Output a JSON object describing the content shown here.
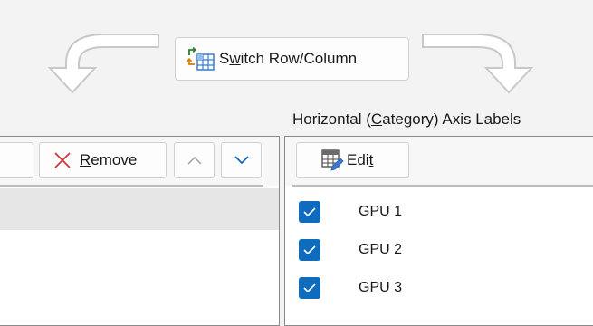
{
  "switch_button": {
    "label_before": "S",
    "label_accel": "w",
    "label_after": "itch Row/Column",
    "icon": "switch-row-column-icon"
  },
  "series_toolbar": {
    "remove_before": "",
    "remove_accel": "R",
    "remove_after": "emove",
    "remove_icon": "remove-x-icon",
    "move_up_icon": "chevron-up-icon",
    "move_down_icon": "chevron-down-icon"
  },
  "category_axis": {
    "title_before": "Horizontal (",
    "title_accel": "C",
    "title_after": "ategory) Axis Labels",
    "edit_before": "Edi",
    "edit_accel": "t",
    "edit_after": "",
    "edit_icon": "edit-table-icon",
    "items": [
      {
        "label": "GPU 1",
        "checked": true
      },
      {
        "label": "GPU 2",
        "checked": true
      },
      {
        "label": "GPU 3",
        "checked": true
      }
    ]
  },
  "colors": {
    "accent": "#0f6cbd",
    "remove_x": "#d13438",
    "selected_row": "#e6e6e6"
  }
}
